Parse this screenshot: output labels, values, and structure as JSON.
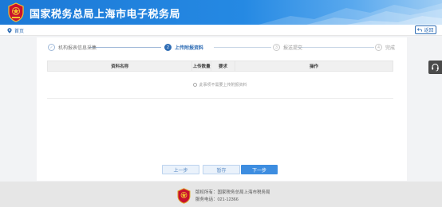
{
  "header": {
    "title": "国家税务总局上海市电子税务局"
  },
  "breadcrumb": {
    "home_label": "首页",
    "back_label": "返回"
  },
  "steps": [
    {
      "num": "✓",
      "label": "机构报表信息采集",
      "state": "done"
    },
    {
      "num": "2",
      "label": "上传附报资料",
      "state": "active"
    },
    {
      "num": "3",
      "label": "报送提交",
      "state": "todo"
    },
    {
      "num": "4",
      "label": "完成",
      "state": "todo"
    }
  ],
  "table": {
    "columns": [
      "资料名称",
      "上传数量",
      "要求",
      "操作"
    ],
    "empty_message": "此事项不需要上传附报资料"
  },
  "buttons": {
    "prev": "上一步",
    "save": "暂存",
    "next": "下一步"
  },
  "footer": {
    "org_line": "版权所有：国家税务总局上海市税务局",
    "phone_line": "服务电话：021-12366"
  },
  "colors": {
    "primary": "#2f6db5",
    "header_start": "#1c79d6",
    "next_button": "#3d8de0",
    "footer_bg": "#e6e6e6"
  },
  "icons": {
    "logo": "tax-emblem-icon",
    "home": "location-pin-icon",
    "back": "return-arrow-icon",
    "side": "headset-icon"
  }
}
